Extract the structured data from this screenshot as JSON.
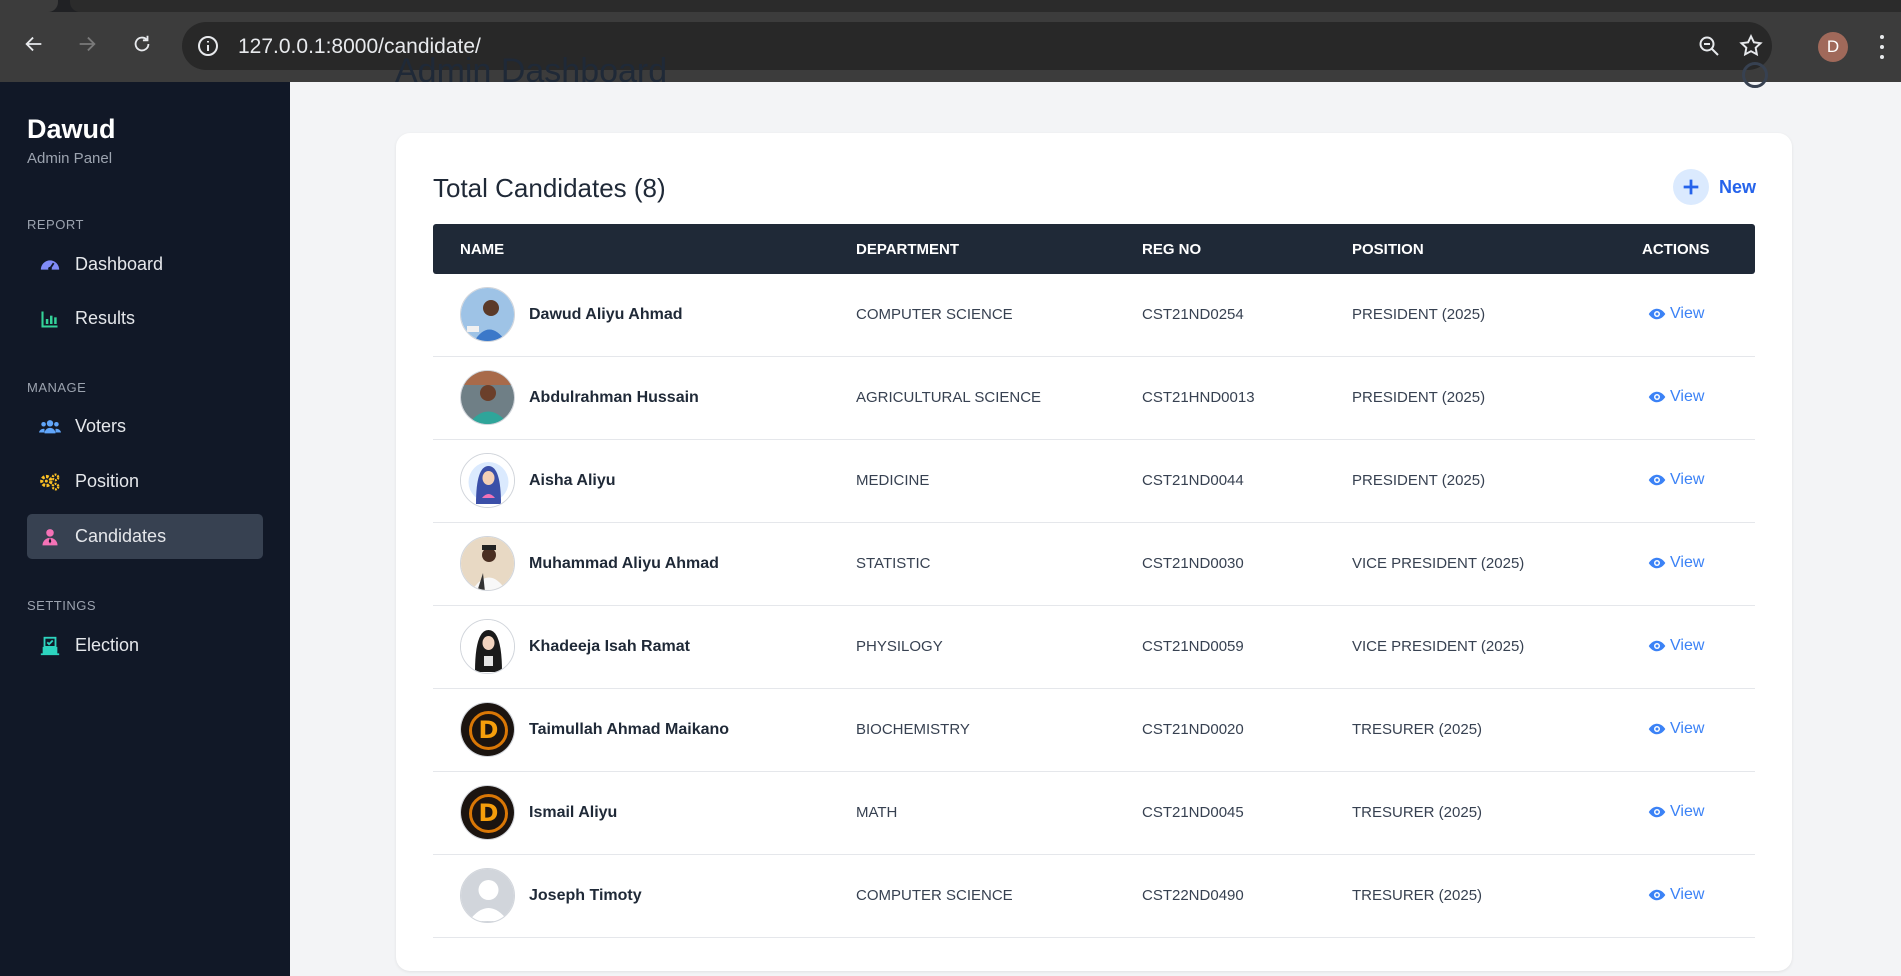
{
  "browser": {
    "url": "127.0.0.1:8000/candidate/",
    "profile_initial": "D"
  },
  "sidebar": {
    "brand": "Dawud",
    "subtitle": "Admin Panel",
    "sections": [
      {
        "label": "REPORT",
        "items": [
          {
            "label": "Dashboard",
            "icon": "gauge-icon",
            "color": "#818cf8"
          },
          {
            "label": "Results",
            "icon": "bar-chart-icon",
            "color": "#34d399"
          }
        ]
      },
      {
        "label": "MANAGE",
        "items": [
          {
            "label": "Voters",
            "icon": "users-icon",
            "color": "#60a5fa"
          },
          {
            "label": "Position",
            "icon": "gears-icon",
            "color": "#fbbf24"
          },
          {
            "label": "Candidates",
            "icon": "user-tie-icon",
            "color": "#f472b6",
            "active": true
          }
        ]
      },
      {
        "label": "SETTINGS",
        "items": [
          {
            "label": "Election",
            "icon": "vote-box-icon",
            "color": "#2dd4bf"
          }
        ]
      }
    ]
  },
  "main": {
    "page_title": "Admin Dashboard",
    "card_title": "Total Candidates (8)",
    "new_label": "New",
    "columns": [
      "NAME",
      "DEPARTMENT",
      "REG NO",
      "POSITION",
      "ACTIONS"
    ],
    "view_label": "View",
    "rows": [
      {
        "name": "Dawud Aliyu Ahmad",
        "department": "COMPUTER SCIENCE",
        "reg_no": "CST21ND0254",
        "position": "PRESIDENT (2025)",
        "avatar": "photo-blue"
      },
      {
        "name": "Abdulrahman Hussain",
        "department": "AGRICULTURAL SCIENCE",
        "reg_no": "CST21HND0013",
        "position": "PRESIDENT (2025)",
        "avatar": "photo-teal"
      },
      {
        "name": "Aisha Aliyu",
        "department": "MEDICINE",
        "reg_no": "CST21ND0044",
        "position": "PRESIDENT (2025)",
        "avatar": "hijab-blue"
      },
      {
        "name": "Muhammad Aliyu Ahmad",
        "department": "STATISTIC",
        "reg_no": "CST21ND0030",
        "position": "VICE PRESIDENT (2025)",
        "avatar": "photo-light"
      },
      {
        "name": "Khadeeja Isah Ramat",
        "department": "PHYSILOGY",
        "reg_no": "CST21ND0059",
        "position": "VICE PRESIDENT (2025)",
        "avatar": "hijab-black"
      },
      {
        "name": "Taimullah Ahmad Maikano",
        "department": "BIOCHEMISTRY",
        "reg_no": "CST21ND0020",
        "position": "TRESURER (2025)",
        "avatar": "logo-dark"
      },
      {
        "name": "Ismail Aliyu",
        "department": "MATH",
        "reg_no": "CST21ND0045",
        "position": "TRESURER (2025)",
        "avatar": "logo-dark"
      },
      {
        "name": "Joseph Timoty",
        "department": "COMPUTER SCIENCE",
        "reg_no": "CST22ND0490",
        "position": "TRESURER (2025)",
        "avatar": "default-user"
      }
    ]
  }
}
